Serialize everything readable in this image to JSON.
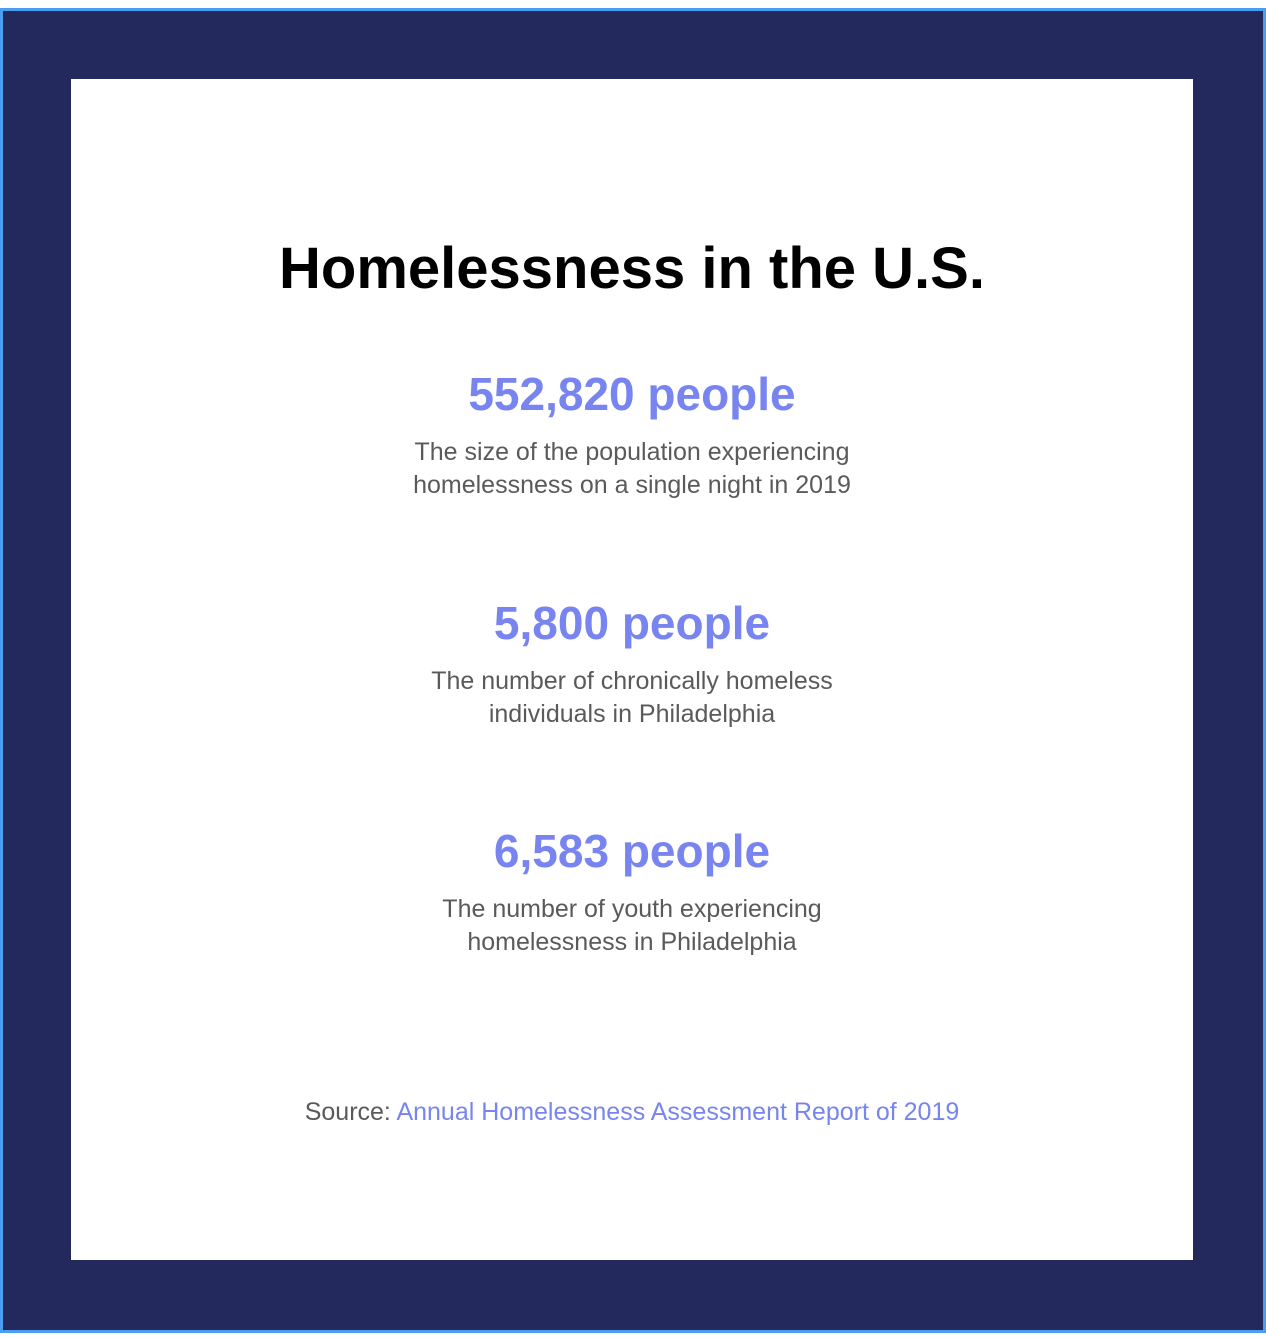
{
  "title": "Homelessness in the U.S.",
  "stats": [
    {
      "value": "552,820 people",
      "description": "The size of the population experiencing\nhomelessness on a single night in 2019"
    },
    {
      "value": "5,800 people",
      "description": "The number of chronically homeless\nindividuals in Philadelphia"
    },
    {
      "value": "6,583 people",
      "description": "The number of youth experiencing\nhomelessness in Philadelphia"
    }
  ],
  "source": {
    "label": "Source: ",
    "link_text": "Annual Homelessness Assessment Report of 2019"
  },
  "colors": {
    "frame": "#23295d",
    "frame_edge": "#4a9ef0",
    "accent": "#7884ef",
    "body_text": "#5a5a5a",
    "title_text": "#000000"
  }
}
